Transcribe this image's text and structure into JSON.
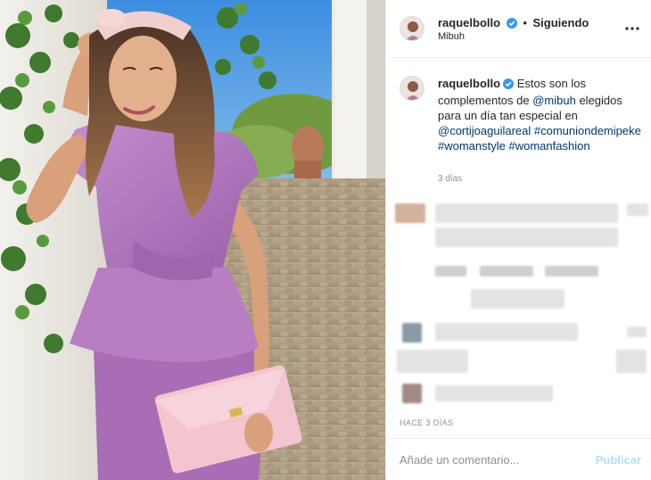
{
  "post": {
    "username": "raquelbollo",
    "follow_separator": "•",
    "follow_label": "Siguiendo",
    "location": "Mibuh",
    "caption": {
      "username": "raquelbollo",
      "text_1": "Estos son los complementos de ",
      "mention_1": "@mibuh",
      "text_2": " elegidos para un día tan especial en ",
      "mention_2": "@cortijoaguilareal",
      "hashtag_1": "#comuniondemipeke",
      "hashtag_2": "#womanstyle",
      "hashtag_3": "#womanfashion",
      "time": "3 días"
    },
    "time_ago": "HACE 3 DÍAS"
  },
  "comment_bar": {
    "placeholder": "Añade un comentario...",
    "publish_label": "Publicar"
  },
  "icons": {
    "verified": "verified-badge-icon",
    "more": "more-options-icon"
  },
  "colors": {
    "verified_blue": "#3897f0",
    "link_blue": "#00376b",
    "publish_disabled": "#b2dffc",
    "dress_lilac": "#b47bc0"
  }
}
